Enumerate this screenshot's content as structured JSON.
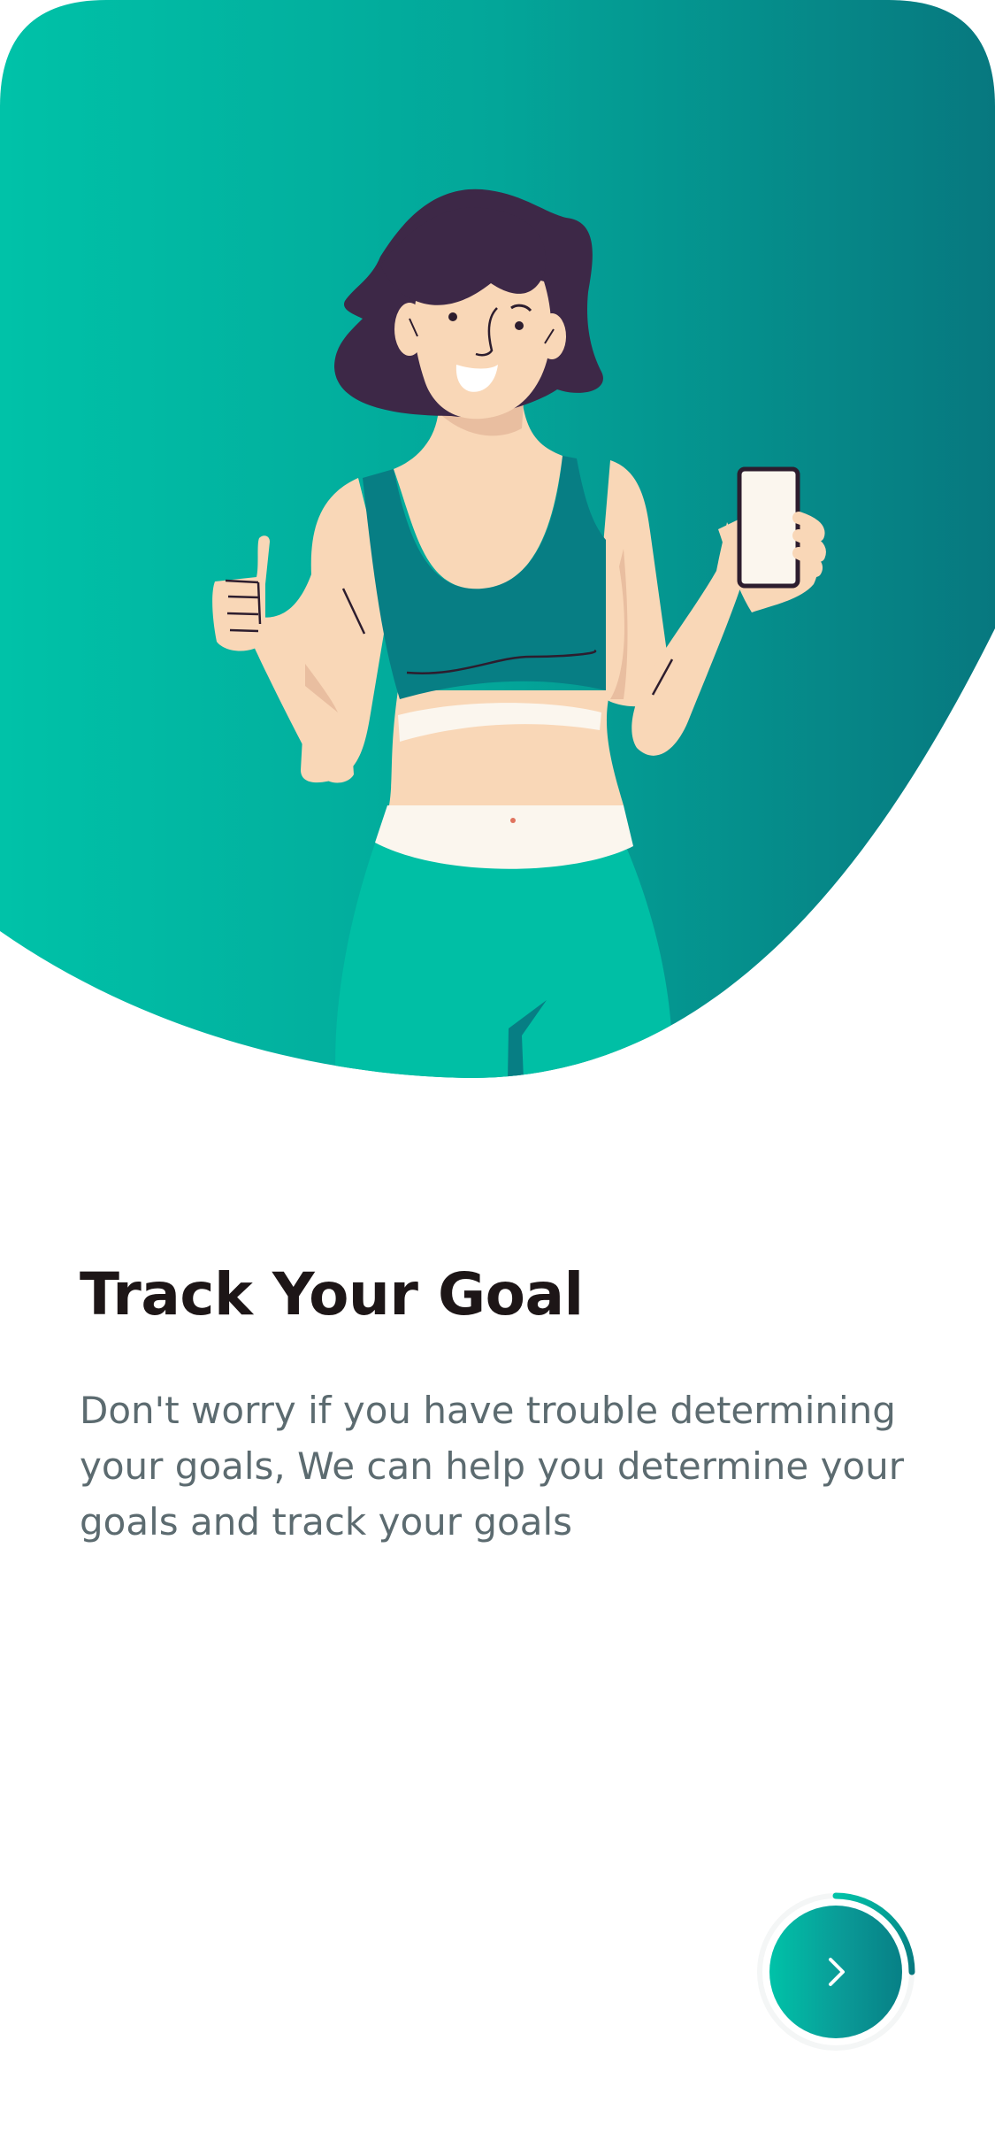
{
  "onboarding": {
    "title": "Track Your Goal",
    "description": "Don't worry if you have trouble determining your goals, We can help you determine your goals and track your goals",
    "progress": 0.25
  },
  "next_button": {
    "label": "Next",
    "icon": "chevron-right-icon"
  },
  "colors": {
    "gradient_start": "#00BFA6",
    "gradient_end": "#07787F",
    "title": "#1D1617",
    "body_text": "#5C6B70",
    "white": "#FFFFFF"
  },
  "illustration": "woman-thumbs-up-holding-phone"
}
